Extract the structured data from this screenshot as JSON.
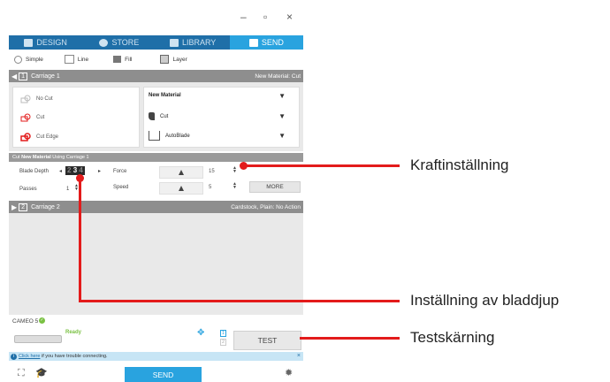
{
  "window": {
    "minimize": "–",
    "maximize": "▫",
    "close": "×"
  },
  "tabs": [
    {
      "label": "DESIGN",
      "icon": "grid-icon"
    },
    {
      "label": "STORE",
      "icon": "store-icon"
    },
    {
      "label": "LIBRARY",
      "icon": "library-icon"
    },
    {
      "label": "SEND",
      "icon": "send-icon",
      "active": true
    }
  ],
  "modes": [
    "Simple",
    "Line",
    "Fill",
    "Layer"
  ],
  "carriage1": {
    "num": "1",
    "label": "Carriage 1",
    "right": "New Material: Cut"
  },
  "cut_options": [
    "No Cut",
    "Cut",
    "Cut Edge"
  ],
  "selects": {
    "material": "New Material",
    "action": "Cut",
    "tool": "AutoBlade"
  },
  "cut_bar": {
    "prefix": "Cut",
    "material": "New Material",
    "suffix": "Using Carriage 1"
  },
  "settings": {
    "blade_depth_label": "Blade Depth",
    "blade_depth_values": [
      "2",
      "3",
      "4"
    ],
    "passes_label": "Passes",
    "passes_value": "1",
    "force_label": "Force",
    "force_value": "15",
    "speed_label": "Speed",
    "speed_value": "5",
    "more_label": "MORE"
  },
  "carriage2": {
    "num": "2",
    "label": "Carriage 2",
    "right": "Cardstock, Plain: No Action"
  },
  "status": {
    "device": "CAMEO 5",
    "ready": "Ready",
    "test_label": "TEST",
    "slot1": "1",
    "slot2": "2"
  },
  "info": {
    "link": "Click here",
    "text": " if you have trouble connecting.",
    "close": "×"
  },
  "bottom": {
    "send_label": "SEND"
  },
  "callouts": {
    "force": "Kraftinställning",
    "blade": "Inställning av bladdjup",
    "test": "Testskärning"
  },
  "colors": {
    "accent": "#29a3df",
    "tab_bar": "#1f6fa8",
    "callout": "#e31b1b",
    "ready": "#7ac143"
  }
}
